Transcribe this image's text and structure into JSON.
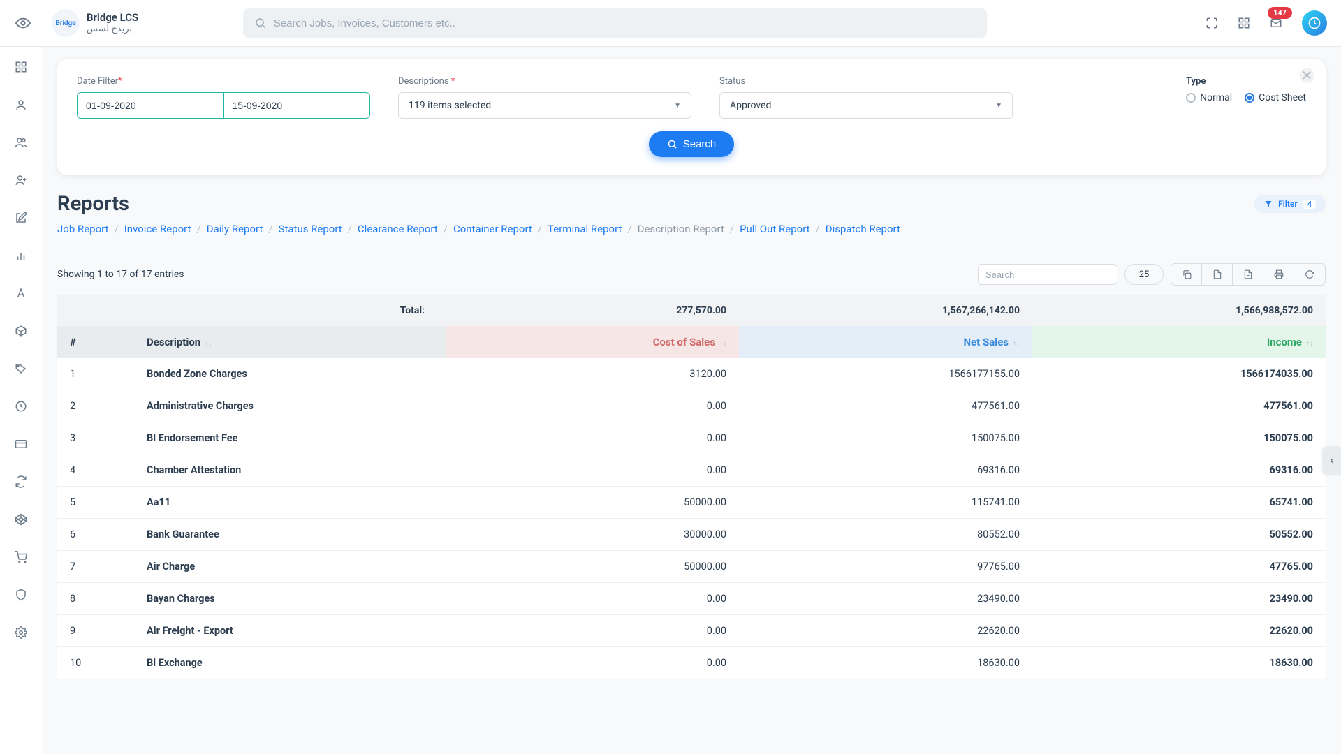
{
  "header": {
    "brand_title": "Bridge LCS",
    "brand_sub": "بريدج لسس",
    "search_placeholder": "Search Jobs, Invoices, Customers etc..",
    "badge_count": "147"
  },
  "filter_panel": {
    "date_label": "Date Filter",
    "date_from": "01-09-2020",
    "date_to": "15-09-2020",
    "desc_label": "Descriptions",
    "desc_value": "119 items selected",
    "status_label": "Status",
    "status_value": "Approved",
    "type_label": "Type",
    "type_normal": "Normal",
    "type_cost_sheet": "Cost Sheet",
    "search_btn": "Search"
  },
  "page": {
    "title": "Reports",
    "filter_pill": "Filter",
    "filter_count": "4"
  },
  "breadcrumb": [
    {
      "label": "Job Report",
      "active": false
    },
    {
      "label": "Invoice Report",
      "active": false
    },
    {
      "label": "Daily Report",
      "active": false
    },
    {
      "label": "Status Report",
      "active": false
    },
    {
      "label": "Clearance Report",
      "active": false
    },
    {
      "label": "Container Report",
      "active": false
    },
    {
      "label": "Terminal Report",
      "active": false
    },
    {
      "label": "Description Report",
      "active": true
    },
    {
      "label": "Pull Out Report",
      "active": false
    },
    {
      "label": "Dispatch Report",
      "active": false
    }
  ],
  "toolbar": {
    "entries_info": "Showing 1 to 17 of 17 entries",
    "search_placeholder": "Search",
    "page_size": "25"
  },
  "table": {
    "totals_label": "Total:",
    "total_cost": "277,570.00",
    "total_net": "1,567,266,142.00",
    "total_income": "1,566,988,572.00",
    "col_hash": "#",
    "col_desc": "Description",
    "col_cost": "Cost of Sales",
    "col_net": "Net Sales",
    "col_income": "Income",
    "rows": [
      {
        "idx": "1",
        "desc": "Bonded Zone Charges",
        "cost": "3120.00",
        "net": "1566177155.00",
        "income": "1566174035.00"
      },
      {
        "idx": "2",
        "desc": "Administrative Charges",
        "cost": "0.00",
        "net": "477561.00",
        "income": "477561.00"
      },
      {
        "idx": "3",
        "desc": "Bl Endorsement Fee",
        "cost": "0.00",
        "net": "150075.00",
        "income": "150075.00"
      },
      {
        "idx": "4",
        "desc": "Chamber Attestation",
        "cost": "0.00",
        "net": "69316.00",
        "income": "69316.00"
      },
      {
        "idx": "5",
        "desc": "Aa11",
        "cost": "50000.00",
        "net": "115741.00",
        "income": "65741.00"
      },
      {
        "idx": "6",
        "desc": "Bank Guarantee",
        "cost": "30000.00",
        "net": "80552.00",
        "income": "50552.00"
      },
      {
        "idx": "7",
        "desc": "Air Charge",
        "cost": "50000.00",
        "net": "97765.00",
        "income": "47765.00"
      },
      {
        "idx": "8",
        "desc": "Bayan Charges",
        "cost": "0.00",
        "net": "23490.00",
        "income": "23490.00"
      },
      {
        "idx": "9",
        "desc": "Air Freight - Export",
        "cost": "0.00",
        "net": "22620.00",
        "income": "22620.00"
      },
      {
        "idx": "10",
        "desc": "Bl Exchange",
        "cost": "0.00",
        "net": "18630.00",
        "income": "18630.00"
      }
    ]
  }
}
